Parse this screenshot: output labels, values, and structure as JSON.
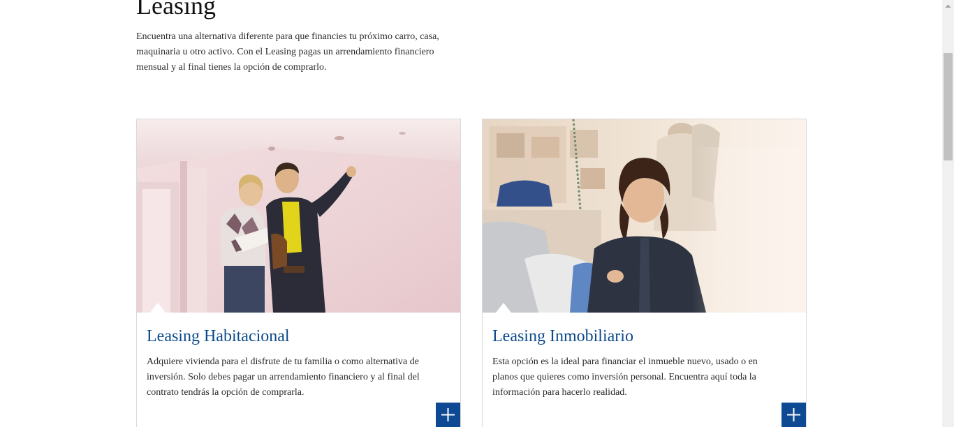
{
  "page": {
    "heading": "Leasing",
    "intro": "Encuentra una alternativa diferente para que financies tu próximo carro, casa, maquinaria u otro activo. Con el Leasing pagas un arrendamiento financiero mensual y al final tienes la opción de comprarlo."
  },
  "cards": [
    {
      "title": "Leasing Habitacional",
      "description": "Adquiere vivienda para el disfrute de tu familia o como alternativa de inversión. Solo debes pagar un arrendamiento financiero y al final del contrato tendrás la opción de comprarla.",
      "image_icon": "couple-house-photo",
      "button_icon": "plus-icon"
    },
    {
      "title": "Leasing Inmobiliario",
      "description": "Esta opción es la ideal para financiar el inmueble nuevo, usado o en planos que quieres como inversión personal. Encuentra aquí toda la información para hacerlo realidad.",
      "image_icon": "shop-owner-photo",
      "button_icon": "plus-icon"
    }
  ],
  "colors": {
    "title_blue": "#0b4a8a",
    "button_blue": "#0d4a93",
    "text": "#2a2a2a"
  }
}
